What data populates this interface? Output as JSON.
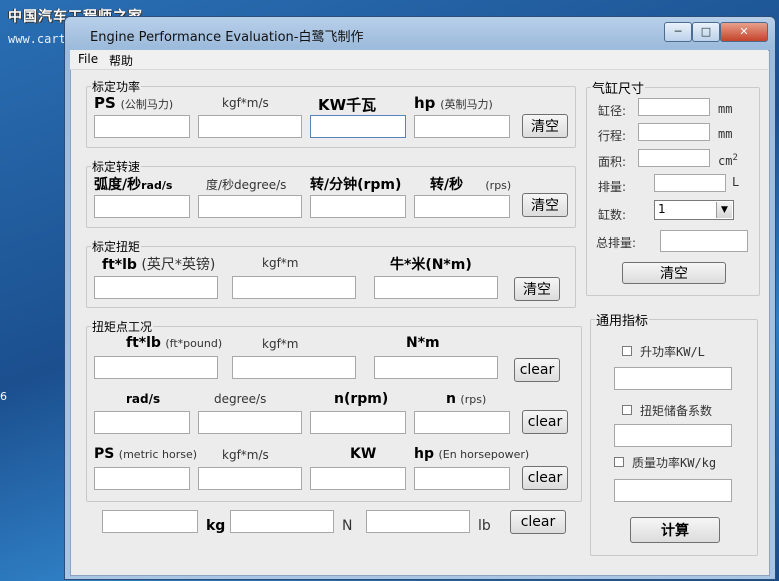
{
  "watermark": {
    "line1": "中国汽车工程师之家",
    "line2": "www.cartech8.com"
  },
  "desktop": {
    "side_label": "6"
  },
  "window": {
    "title": "Engine Performance Evaluation-白鹭飞制作",
    "min": "─",
    "max": "□",
    "close": "✕"
  },
  "menu": {
    "file": "File",
    "help": "帮助"
  },
  "power": {
    "legend": "标定功率",
    "ps": "PS",
    "ps_unit": "(公制马力)",
    "kgf": "kgf*m/s",
    "kw": "KW千瓦",
    "hp": "hp",
    "hp_unit": "(英制马力)",
    "clear": "清空"
  },
  "speed": {
    "legend": "标定转速",
    "rad": "弧度/秒",
    "rad_unit": "rad/s",
    "deg": "度/秒degree/s",
    "rpm": "转/分钟(rpm)",
    "rps": "转/秒",
    "rps_unit": "(rps)",
    "clear": "清空"
  },
  "torque": {
    "legend": "标定扭矩",
    "ftlb": "ft*lb",
    "ftlb_unit": "(英尺*英镑)",
    "kgfm": "kgf*m",
    "nm": "牛*米(N*m)",
    "clear": "清空"
  },
  "point": {
    "legend": "扭矩点工况",
    "ftlb": "ft*lb",
    "ftlb_unit": "(ft*pound)",
    "kgfm": "kgf*m",
    "nm": "N*m",
    "clear": "clear",
    "rad": "rad/s",
    "deg": "degree/s",
    "rpm": "n(rpm)",
    "n": "n",
    "n_unit": "(rps)",
    "ps": "PS",
    "ps_unit": "(metric horse)",
    "kgfms": "kgf*m/s",
    "kw": "KW",
    "hp": "hp",
    "hp_unit": "(En horsepower)"
  },
  "mass": {
    "kg": "kg",
    "n": "N",
    "lb": "lb",
    "clear": "clear"
  },
  "cylinder": {
    "legend": "气缸尺寸",
    "bore": "缸径:",
    "bore_unit": "mm",
    "stroke": "行程:",
    "stroke_unit": "mm",
    "area": "面积:",
    "area_unit": "cm",
    "area_sup": "2",
    "disp": "排量:",
    "disp_unit": "L",
    "count": "缸数:",
    "count_value": "1",
    "total": "总排量:",
    "clear": "清空"
  },
  "general": {
    "legend": "通用指标",
    "liter_power": "升功率KW/L",
    "torque_reserve": "扭矩储备系数",
    "mass_power": "质量功率KW/kg",
    "calc": "计算"
  }
}
